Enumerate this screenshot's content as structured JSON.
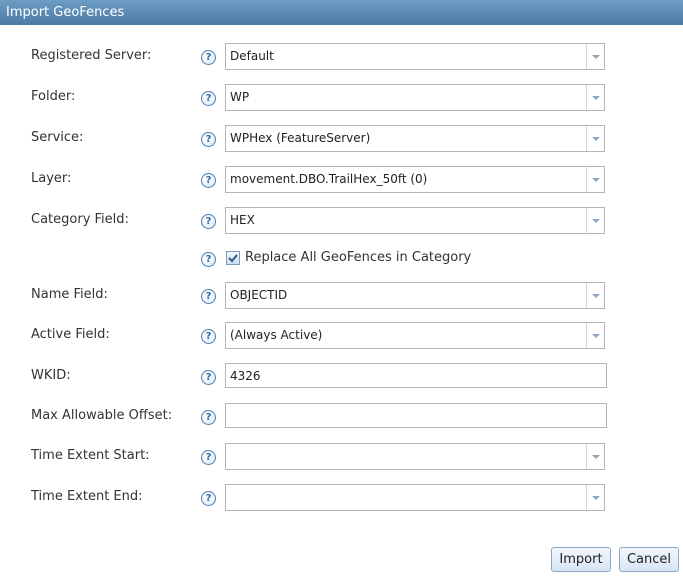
{
  "dialog": {
    "title": "Import GeoFences"
  },
  "fields": {
    "registered_server": {
      "label": "Registered Server:",
      "value": "Default"
    },
    "folder": {
      "label": "Folder:",
      "value": "WP"
    },
    "service": {
      "label": "Service:",
      "value": "WPHex (FeatureServer)"
    },
    "layer": {
      "label": "Layer:",
      "value": "movement.DBO.TrailHex_50ft (0)"
    },
    "category_field": {
      "label": "Category Field:",
      "value": "HEX"
    },
    "replace_all": {
      "label": "Replace All GeoFences in Category",
      "checked": true
    },
    "name_field": {
      "label": "Name Field:",
      "value": "OBJECTID"
    },
    "active_field": {
      "label": "Active Field:",
      "value": "(Always Active)"
    },
    "wkid": {
      "label": "WKID:",
      "value": "4326"
    },
    "max_offset": {
      "label": "Max Allowable Offset:",
      "value": ""
    },
    "time_start": {
      "label": "Time Extent Start:",
      "value": ""
    },
    "time_end": {
      "label": "Time Extent End:",
      "value": ""
    }
  },
  "help_glyph": "?",
  "buttons": {
    "import": "Import",
    "cancel": "Cancel"
  },
  "colors": {
    "titlebar": "#5a89b5",
    "help_icon": "#2d6aa3",
    "button_border": "#8aa7c6"
  }
}
